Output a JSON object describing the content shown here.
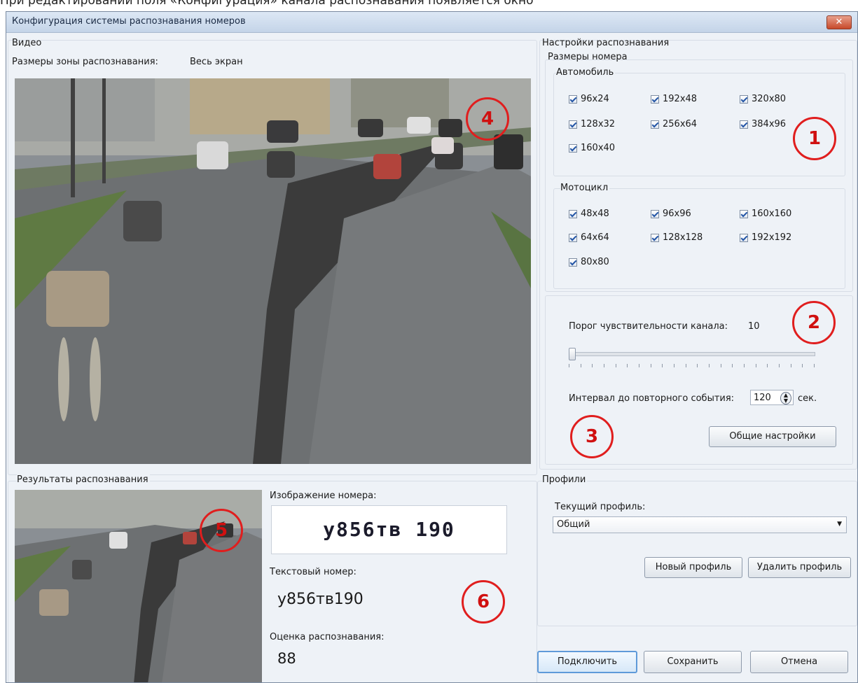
{
  "caption": "При редактировании поля «Конфигурация» канала распознавания появляется окно",
  "window": {
    "title": "Конфигурация системы распознавания номеров",
    "close_glyph": "✕"
  },
  "video": {
    "group_label": "Видео",
    "zone_label": "Размеры зоны распознавания:",
    "zone_value": "Весь экран"
  },
  "recognition": {
    "group_label": "Настройки распознавания",
    "plate_sizes_label": "Размеры номера",
    "car_label": "Автомобиль",
    "car_sizes": [
      "96x24",
      "192x48",
      "320x80",
      "128x32",
      "256x64",
      "384x96",
      "160x40"
    ],
    "moto_label": "Мотоцикл",
    "moto_sizes": [
      "48x48",
      "96x96",
      "160x160",
      "64x64",
      "128x128",
      "192x192",
      "80x80"
    ],
    "threshold_label": "Порог чувствительности канала:",
    "threshold_value": "10",
    "threshold_level": 0.0,
    "interval_label": "Интервал до повторного события:",
    "interval_value": "120",
    "interval_unit": "сек.",
    "general_settings_button": "Общие настройки"
  },
  "results": {
    "group_label": "Результаты распознавания",
    "plate_image_label": "Изображение номера:",
    "plate_image_text": "у856тв 190",
    "text_plate_label": "Текстовый номер:",
    "text_plate_value": "у856тв190",
    "score_label": "Оценка распознавания:",
    "score_value": "88"
  },
  "profiles": {
    "group_label": "Профили",
    "current_label": "Текущий профиль:",
    "current_value": "Общий",
    "new_button": "Новый профиль",
    "delete_button": "Удалить профиль"
  },
  "footer": {
    "connect_button": "Подключить",
    "save_button": "Сохранить",
    "cancel_button": "Отмена"
  },
  "callouts": [
    "1",
    "2",
    "3",
    "4",
    "5",
    "6"
  ],
  "colors": {
    "callout": "#e01e1e",
    "window_bg": "#eef2f7"
  }
}
